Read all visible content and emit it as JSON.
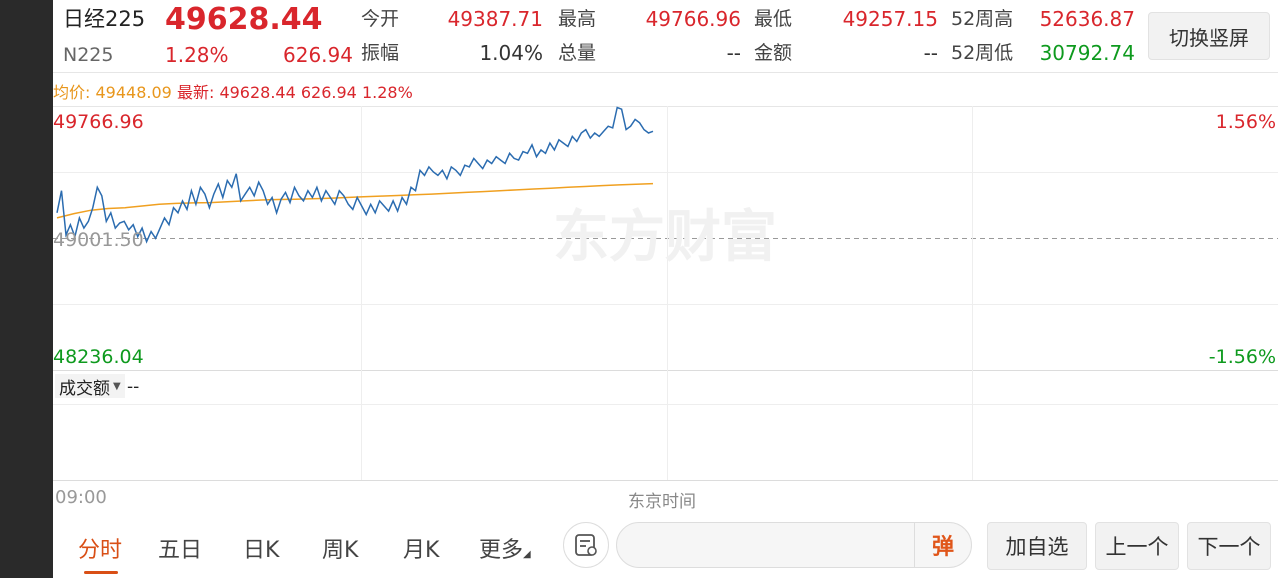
{
  "header": {
    "name": "日经225",
    "price": "49628.44",
    "code": "N225",
    "change_pct": "1.28%",
    "change": "626.94",
    "stats": [
      {
        "label": "今开",
        "value": "49387.71"
      },
      {
        "label": "最高",
        "value": "49766.96"
      },
      {
        "label": "最低",
        "value": "49257.15"
      },
      {
        "label": "52周高",
        "value": "52636.87"
      },
      {
        "label": "振幅",
        "value": "1.04%"
      },
      {
        "label": "总量",
        "value": "--"
      },
      {
        "label": "金额",
        "value": "--"
      },
      {
        "label": "52周低",
        "value": "30792.74"
      }
    ],
    "switch_label": "切换竖屏"
  },
  "summary": {
    "avg_label": "均价:",
    "avg_value": "49448.09",
    "latest_label": "最新:",
    "latest_value": "49628.44",
    "latest_change": "626.94",
    "latest_pct": "1.28%"
  },
  "chart": {
    "y_top_label": "49766.96",
    "y_mid_label": "49001.50",
    "y_bot_label": "48236.04",
    "pct_top_label": "1.56%",
    "pct_bot_label": "-1.56%",
    "watermark": "东方财富",
    "x_start_label": "09:00",
    "x_mid_label": "东京时间",
    "colors": {
      "price_line": "#2b6cb0",
      "avg_line": "#f0a020",
      "up": "#d9262c",
      "down": "#0e9a1e"
    }
  },
  "chart_data": {
    "type": "line",
    "ylim": [
      48236.04,
      49766.96
    ],
    "y_ref": 49001.5,
    "series": [
      {
        "name": "",
        "values": [
          49150,
          49280,
          49020,
          49080,
          49010,
          49120,
          49060,
          49100,
          49180,
          49300,
          49250,
          49100,
          49150,
          49060,
          49090,
          49100,
          49050,
          49080,
          49010,
          49060,
          48980,
          49040,
          49000,
          49060,
          49120,
          49080,
          49180,
          49150,
          49220,
          49170,
          49280,
          49200,
          49300,
          49260,
          49180,
          49260,
          49320,
          49240,
          49340,
          49300,
          49380,
          49220,
          49260,
          49300,
          49250,
          49330,
          49280,
          49200,
          49240,
          49150,
          49230,
          49270,
          49210,
          49300,
          49250,
          49220,
          49280,
          49240,
          49300,
          49220,
          49280,
          49240,
          49200,
          49280,
          49250,
          49200,
          49170,
          49240,
          49190,
          49140,
          49200,
          49150,
          49220,
          49190,
          49160,
          49220,
          49160,
          49240,
          49200,
          49300,
          49280,
          49400,
          49370,
          49420,
          49390,
          49370,
          49400,
          49350,
          49420,
          49400,
          49370,
          49430,
          49420,
          49470,
          49440,
          49410,
          49460,
          49440,
          49480,
          49460,
          49440,
          49500,
          49470,
          49460,
          49510,
          49500,
          49550,
          49480,
          49520,
          49500,
          49560,
          49520,
          49580,
          49560,
          49540,
          49600,
          49570,
          49620,
          49640,
          49590,
          49620,
          49600,
          49630,
          49660,
          49650,
          49770,
          49760,
          49640,
          49660,
          49700,
          49680,
          49640,
          49620,
          49630
        ]
      },
      {
        "name": "",
        "values": [
          49120,
          49145,
          49165,
          49175,
          49180,
          49190,
          49200,
          49205,
          49208,
          49210,
          49215,
          49220,
          49225,
          49228,
          49230,
          49233,
          49236,
          49240,
          49244,
          49248,
          49252,
          49256,
          49260,
          49265,
          49270,
          49275,
          49280,
          49285,
          49290,
          49295,
          49300,
          49305,
          49310,
          49314,
          49318,
          49322
        ]
      }
    ]
  },
  "volume": {
    "selector_label": "成交额",
    "value": "--"
  },
  "tabs": [
    {
      "label": "分时"
    },
    {
      "label": "五日"
    },
    {
      "label": "日K"
    },
    {
      "label": "周K"
    },
    {
      "label": "月K"
    },
    {
      "label": "更多"
    }
  ],
  "bottom": {
    "danmu_label": "弹",
    "input_placeholder": "",
    "add_watch": "加自选",
    "prev": "上一个",
    "next": "下一个"
  }
}
